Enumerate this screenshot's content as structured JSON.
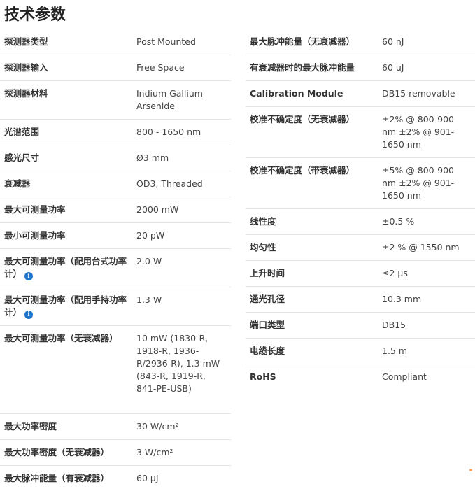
{
  "title": "技术参数",
  "left": [
    {
      "k": "探测器类型",
      "v": "Post Mounted"
    },
    {
      "k": "探测器输入",
      "v": "Free Space"
    },
    {
      "k": "探测器材料",
      "v": "Indium Gallium Arsenide"
    },
    {
      "k": "光谱范围",
      "v": "800 - 1650 nm"
    },
    {
      "k": "感光尺寸",
      "v": "Ø3 mm"
    },
    {
      "k": "衰减器",
      "v": "OD3, Threaded"
    },
    {
      "k": "最大可测量功率",
      "v": "2000 mW"
    },
    {
      "k": "最小可测量功率",
      "v": "20 pW"
    },
    {
      "k": "最大可测量功率（配用台式功率计）",
      "v": "2.0 W",
      "info": true
    },
    {
      "k": "最大可测量功率（配用手持功率计）",
      "v": "1.3 W",
      "info": true
    },
    {
      "k": "最大可测量功率（无衰减器）",
      "v": "10 mW (1830-R, 1918-R, 1936-R/2936-R), 1.3 mW (843-R, 1919-R, 841-PE-USB)"
    },
    {
      "k": "最大功率密度",
      "v": "30 W/cm²"
    },
    {
      "k": "最大功率密度（无衰减器）",
      "v": "3 W/cm²"
    },
    {
      "k": "最大脉冲能量（有衰减器）",
      "v": "60 μJ"
    }
  ],
  "right": [
    {
      "k": "最大脉冲能量（无衰减器）",
      "v": "60 nJ"
    },
    {
      "k": "有衰减器时的最大脉冲能量",
      "v": "60 uJ"
    },
    {
      "k": "Calibration Module",
      "v": "DB15 removable"
    },
    {
      "k": "校准不确定度（无衰减器）",
      "v": "±2% @ 800-900 nm ±2% @ 901-1650 nm"
    },
    {
      "k": "校准不确定度（带衰减器）",
      "v": "±5% @ 800-900 nm ±2% @ 901-1650 nm"
    },
    {
      "k": "线性度",
      "v": "±0.5 %"
    },
    {
      "k": "均匀性",
      "v": "±2 % @ 1550 nm"
    },
    {
      "k": "上升时间",
      "v": "≤2 μs"
    },
    {
      "k": "通光孔径",
      "v": "10.3 mm"
    },
    {
      "k": "端口类型",
      "v": "DB15"
    },
    {
      "k": "电缆长度",
      "v": "1.5 m"
    },
    {
      "k": "RoHS",
      "v": "Compliant"
    }
  ],
  "info_icon_glyph": "i",
  "info_icon_color": "#1f74c8"
}
